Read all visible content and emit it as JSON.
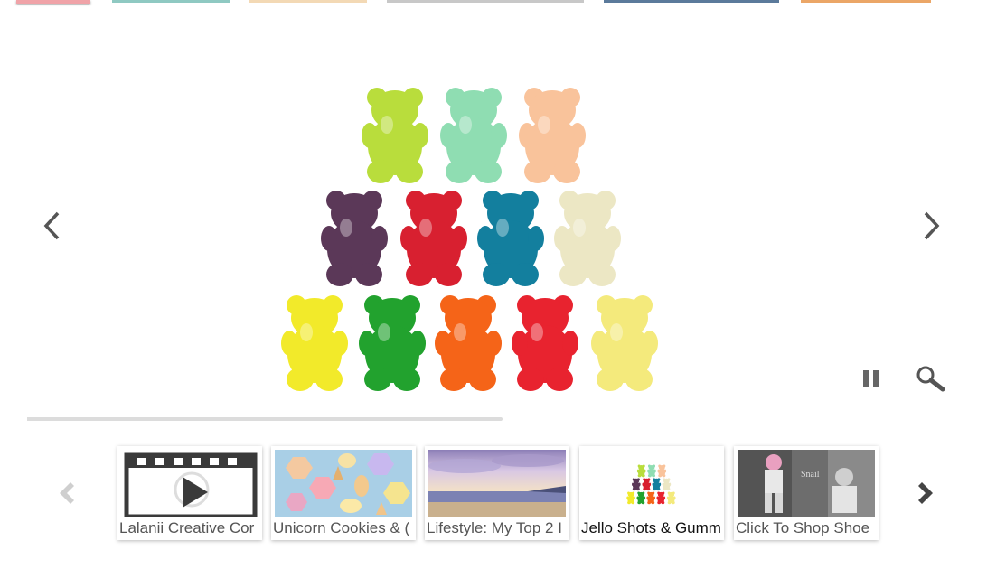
{
  "colors": {
    "tabs": [
      "#f0a3a8",
      "#8fc9c2",
      "#f3d9b5",
      "#c8c8c8",
      "#5b7a9b",
      "#eba667"
    ],
    "arrow": "#555555",
    "arrow_disabled": "#cfcfcf",
    "progress": "#dcdcdc"
  },
  "slideshow": {
    "progress": 0.5,
    "icons": {
      "prev": "chevron-left-icon",
      "next": "chevron-right-icon",
      "pause": "pause-icon",
      "zoom": "magnifier-icon"
    }
  },
  "thumbnails": [
    {
      "caption": "Lalanii Creative Cor",
      "icon": "film-play-icon"
    },
    {
      "caption": "Unicorn Cookies & (",
      "icon": "cookies-image"
    },
    {
      "caption": "Lifestyle: My Top 2 I",
      "icon": "beach-sunset-image"
    },
    {
      "caption": "Jello Shots & Gumm",
      "icon": "gummy-bears-image",
      "active": true
    },
    {
      "caption": "Click To Shop Shoe",
      "icon": "fashion-photo-image"
    }
  ]
}
